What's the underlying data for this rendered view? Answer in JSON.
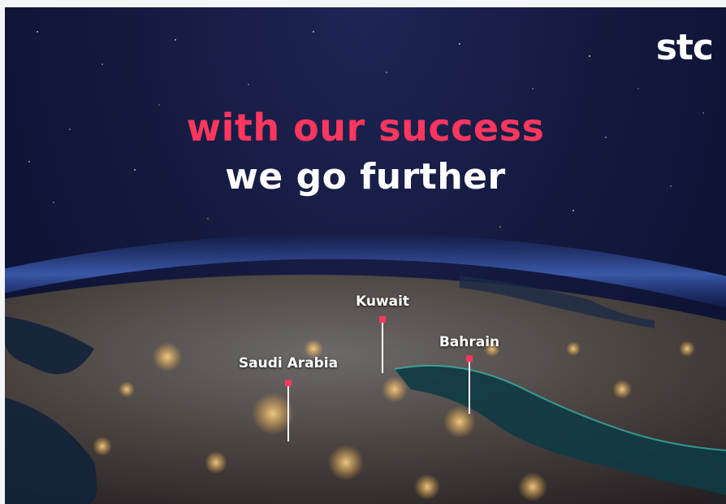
{
  "brand": {
    "logo_text": "stc"
  },
  "headline": {
    "line1": "with our success",
    "line2": "we go further"
  },
  "markers": [
    {
      "name": "Kuwait"
    },
    {
      "name": "Bahrain"
    },
    {
      "name": "Saudi Arabia"
    }
  ],
  "colors": {
    "accent": "#ff375e",
    "space": "#141a3f",
    "text": "#ffffff"
  }
}
